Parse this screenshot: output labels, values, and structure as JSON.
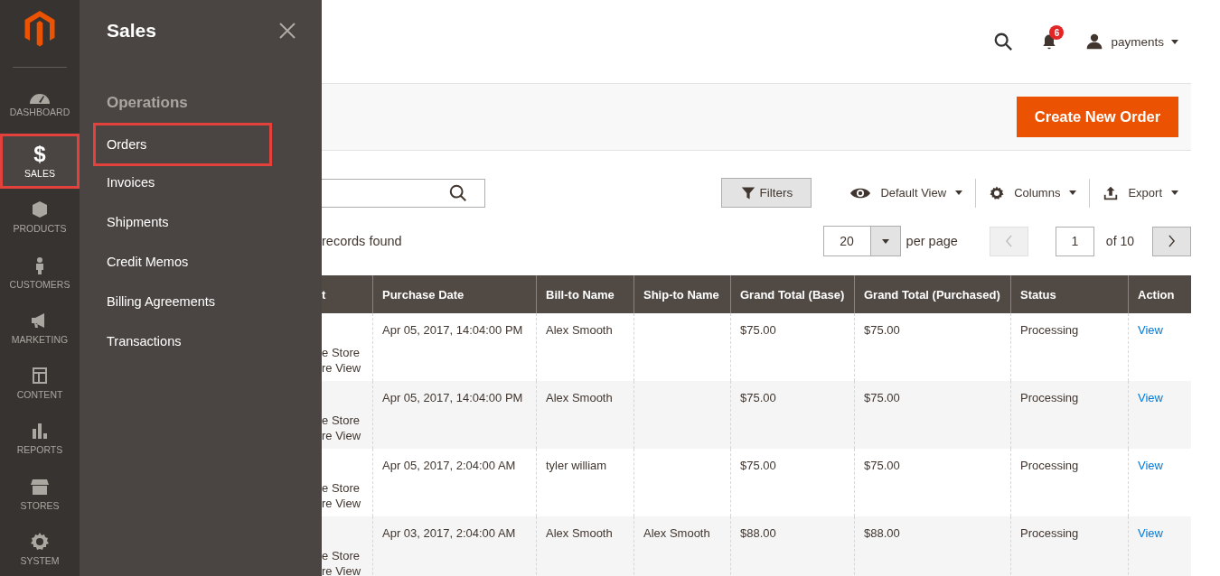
{
  "nav": {
    "items": [
      {
        "kind": "dashboard",
        "label": "DASHBOARD",
        "selected": false
      },
      {
        "kind": "sales",
        "icon": "$",
        "label": "SALES",
        "selected": true
      },
      {
        "kind": "products",
        "label": "PRODUCTS",
        "selected": false
      },
      {
        "kind": "customers",
        "label": "CUSTOMERS",
        "selected": false
      },
      {
        "kind": "marketing",
        "label": "MARKETING",
        "selected": false
      },
      {
        "kind": "content",
        "label": "CONTENT",
        "selected": false
      },
      {
        "kind": "reports",
        "label": "REPORTS",
        "selected": false
      },
      {
        "kind": "stores",
        "label": "STORES",
        "selected": false
      },
      {
        "kind": "system",
        "label": "SYSTEM",
        "selected": false
      }
    ]
  },
  "flyout": {
    "title": "Sales",
    "section": "Operations",
    "items": [
      {
        "label": "Orders",
        "selected": true
      },
      {
        "label": "Invoices",
        "selected": false
      },
      {
        "label": "Shipments",
        "selected": false
      },
      {
        "label": "Credit Memos",
        "selected": false
      },
      {
        "label": "Billing Agreements",
        "selected": false
      },
      {
        "label": "Transactions",
        "selected": false
      }
    ]
  },
  "header": {
    "notifications": "6",
    "user": "payments"
  },
  "page_actions": {
    "primary_button": "Create New Order"
  },
  "toolbar": {
    "filters": "Filters",
    "view": "Default View",
    "columns": "Columns",
    "export": "Export"
  },
  "grid": {
    "records_text": "records found",
    "per_page_value": "20",
    "per_page_label": "per page",
    "page": "1",
    "page_total": "of 10"
  },
  "table": {
    "columns": [
      "t",
      "Purchase Date",
      "Bill-to Name",
      "Ship-to Name",
      "Grand Total (Base)",
      "Grand Total (Purchased)",
      "Status",
      "Action"
    ],
    "rows": [
      {
        "column_1": [
          "e Store",
          "re View"
        ],
        "date": "Apr 05, 2017, 14:04:00 PM",
        "bill_to": "Alex Smooth",
        "ship_to": "",
        "total_base": "$75.00",
        "total_purchased": "$75.00",
        "status": "Processing",
        "action": "View"
      },
      {
        "column_1": [
          "e Store",
          "re View"
        ],
        "date": "Apr 05, 2017, 14:04:00 PM",
        "bill_to": "Alex Smooth",
        "ship_to": "",
        "total_base": "$75.00",
        "total_purchased": "$75.00",
        "status": "Processing",
        "action": "View"
      },
      {
        "column_1": [
          "e Store",
          "re View"
        ],
        "date": "Apr 05, 2017, 2:04:00 AM",
        "bill_to": "tyler william",
        "ship_to": "",
        "total_base": "$75.00",
        "total_purchased": "$75.00",
        "status": "Processing",
        "action": "View"
      },
      {
        "column_1": [
          "e Store",
          "re View"
        ],
        "date": "Apr 03, 2017, 2:04:00 AM",
        "bill_to": "Alex Smooth",
        "ship_to": "Alex Smooth",
        "total_base": "$88.00",
        "total_purchased": "$88.00",
        "status": "Processing",
        "action": "View"
      }
    ]
  }
}
